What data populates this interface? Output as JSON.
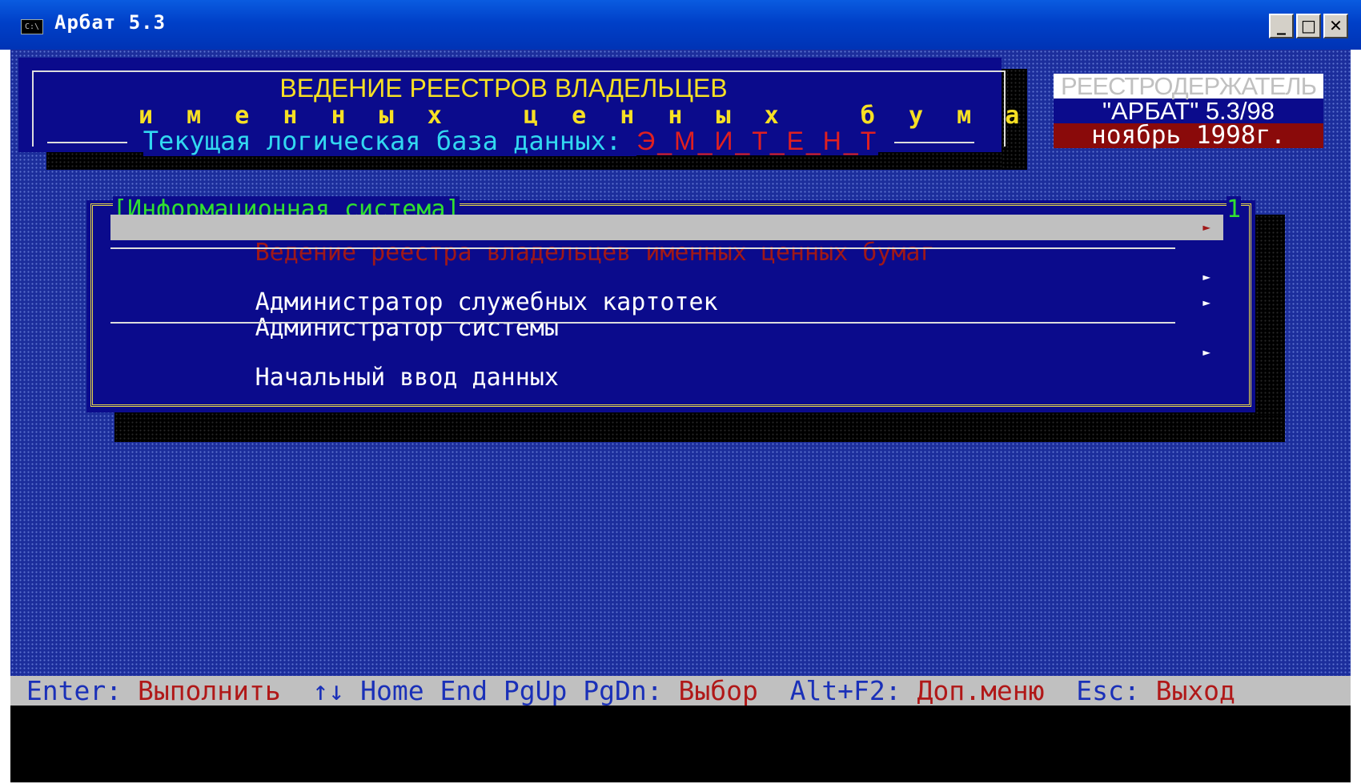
{
  "window": {
    "title": "Арбат 5.3",
    "icon": "C:\\",
    "minimize": "_",
    "maximize": "□",
    "close": "✕"
  },
  "header": {
    "line1": "ВЕДЕНИЕ РЕЕСТРОВ ВЛАДЕЛЬЦЕВ",
    "line2": "и м е н н ы х   ц е н н ы х   б у м а г",
    "db_label": "Текущая логическая база данных: ",
    "db_name": "Э_М_И_Т_Е_Н_Т"
  },
  "badge": {
    "line1": "РЕЕСТРОДЕРЖАТЕЛЬ",
    "line2": "\"АРБАТ\" 5.3/98",
    "line3": "ноябрь 1998г."
  },
  "menu": {
    "title": "[Информационная система]",
    "number": "1",
    "items": [
      {
        "label": "Ведение реестра владельцев именных ценных бумаг",
        "arrow": "►"
      },
      {
        "label": "Администратор служебных картотек",
        "arrow": "►"
      },
      {
        "label": "Администратор системы",
        "arrow": "►"
      },
      {
        "label": "Начальный ввод данных",
        "arrow": "►"
      }
    ]
  },
  "statusbar": {
    "enter_key": "Enter: ",
    "enter_action": "Выполнить",
    "nav_keys": "↑↓ Home End PgUp PgDn: ",
    "nav_action": "Выбор",
    "alt_key": "Alt+F2: ",
    "alt_action": "Доп.меню",
    "esc_key": "Esc: ",
    "esc_action": "Выход"
  },
  "colors": {
    "desktop": "#1c2e9c",
    "panel": "#0b0b8c",
    "header_text": "#f7e024",
    "db_label": "#32d8f0",
    "db_name": "#e02020",
    "menu_title": "#30e030",
    "selection_bg": "#c0c0c0",
    "selection_fg": "#a01818"
  }
}
